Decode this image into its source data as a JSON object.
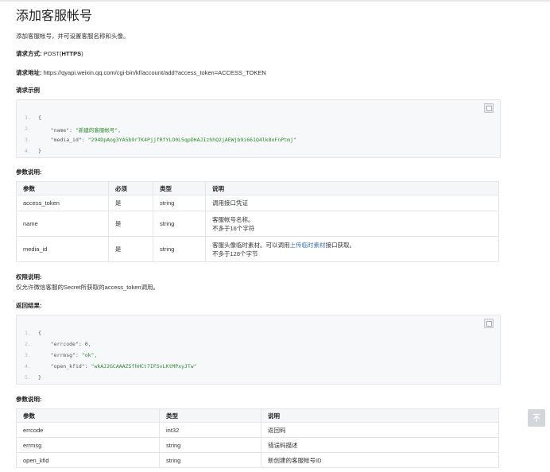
{
  "title": "添加客服帐号",
  "intro": "添加客服帐号，并可设置客服名称和头像。",
  "method": {
    "label": "请求方式:",
    "value_prefix": "POST(",
    "value_bold": "HTTPS",
    "value_suffix": ")"
  },
  "url": {
    "label": "请求地址:",
    "value": "https://qyapi.weixin.qq.com/cgi-bin/kf/account/add?access_token=ACCESS_TOKEN"
  },
  "request_example_label": "请求示例",
  "request_code": [
    {
      "num": "1.",
      "key": "",
      "value": "{"
    },
    {
      "num": "2.",
      "key": "    \"name\": ",
      "value": "\"新建的客服帐号\","
    },
    {
      "num": "3.",
      "key": "    \"media_id\": ",
      "value": "\"294DpAog3YA5b9rTK4PjjfRfYLO0L5qpDHAJIzhhQ2jAEWjb9i661Q4lk8oFnPtmj\""
    },
    {
      "num": "4.",
      "key": "",
      "value": "}"
    }
  ],
  "params_label": "参数说明:",
  "params_table": {
    "headers": [
      "参数",
      "必须",
      "类型",
      "说明"
    ],
    "rows": [
      {
        "param": "access_token",
        "required": "是",
        "type": "string",
        "desc1": "调用接口凭证",
        "desc2": ""
      },
      {
        "param": "name",
        "required": "是",
        "type": "string",
        "desc1": "客服帐号名称。",
        "desc2": "不多于16个字符"
      },
      {
        "param": "media_id",
        "required": "是",
        "type": "string",
        "desc1_pre": "客服头像临时素材。可以调用",
        "desc1_link": "上传临时素材",
        "desc1_post": "接口获取。",
        "desc2": "不多于128个字节"
      }
    ]
  },
  "permission_label": "权限说明:",
  "permission_text": "仅允许微信客服的Secret所获取的access_token调用。",
  "result_label": "返回结果:",
  "response_code": [
    {
      "num": "1.",
      "key": "",
      "value": "{"
    },
    {
      "num": "2.",
      "key": "    \"errcode\": ",
      "value": "0,"
    },
    {
      "num": "3.",
      "key": "    \"errmsg\": ",
      "value": "\"ok\","
    },
    {
      "num": "4.",
      "key": "    \"open_kfid\": ",
      "value": "\"wkAJ2GCAAAZSfhHCt7IFSvLKtMPxyJTw\""
    },
    {
      "num": "5.",
      "key": "",
      "value": "}"
    }
  ],
  "result_params_label": "参数说明:",
  "result_table": {
    "headers": [
      "参数",
      "类型",
      "说明"
    ],
    "rows": [
      {
        "param": "errcode",
        "type": "int32",
        "desc": "返回码"
      },
      {
        "param": "errmsg",
        "type": "string",
        "desc": "错误码描述"
      },
      {
        "param": "open_kfid",
        "type": "string",
        "desc": "新创建的客服帐号ID"
      }
    ]
  },
  "icons": {
    "copy": "copy-icon",
    "back_to_top": "arrow-up-icon"
  },
  "colors": {
    "link": "#3b6fb6",
    "code_bg": "#f7f8fa",
    "string": "#2a8a2a"
  }
}
